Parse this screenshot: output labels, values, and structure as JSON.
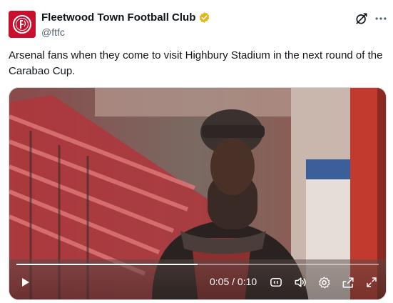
{
  "account": {
    "display_name": "Fleetwood Town Football Club",
    "handle": "@ftfc",
    "avatar_icon": "fleetwood-crest-icon",
    "verified_icon": "verified-gold-badge-icon",
    "brand_color": "#c8102e",
    "verified_color": "#e2b719"
  },
  "header_actions": {
    "grok_icon": "grok-icon",
    "more_icon": "more-horizontal-icon"
  },
  "tweet": {
    "text": "Arsenal fans when they come to visit Highbury Stadium in the next round of the Carabao Cup."
  },
  "video": {
    "current_time": "0:05",
    "separator": " / ",
    "duration": "0:10",
    "progress": 0.5,
    "controls": {
      "play_icon": "play-icon",
      "captions_icon": "closed-captions-icon",
      "volume_icon": "volume-icon",
      "settings_icon": "gear-icon",
      "popout_icon": "picture-in-picture-icon",
      "fullscreen_icon": "fullscreen-icon"
    }
  }
}
